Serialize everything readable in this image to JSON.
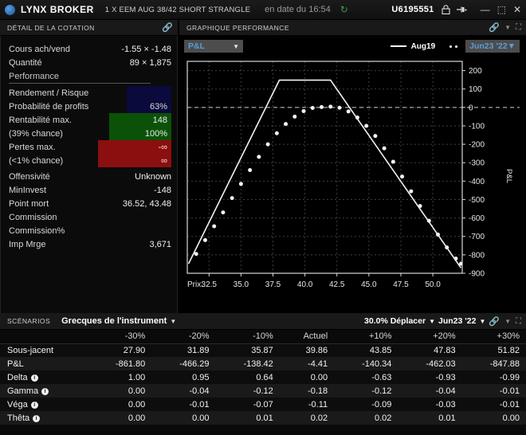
{
  "titlebar": {
    "brand": "LYNX BROKER",
    "description": "1 X EEM AUG 38/42 SHORT STRANGLE",
    "date_label": "en date du 16:54",
    "account": "U6195551",
    "refresh_icon": "refresh-icon",
    "lock_icon": "lock-icon",
    "pin_icon": "pin-icon",
    "minimize": "—",
    "maximize": "⬚",
    "close": "✕"
  },
  "quote_panel": {
    "header": "DÉTAIL DE LA COTATION",
    "rows": [
      {
        "label": "Cours ach/vend",
        "value": "-1.55 × -1.48"
      },
      {
        "label": "Quantité",
        "value": "89 × 1,875"
      }
    ],
    "section_label": "Performance",
    "perf": [
      {
        "label": "Rendement / Risque",
        "value": "",
        "style": "navy"
      },
      {
        "label": "Probabilité de profits",
        "value": "63%",
        "style": "navy"
      },
      {
        "label": "Rentabilité max.",
        "value": "148",
        "style": "green"
      },
      {
        "label": "(39% chance)",
        "value": "100%",
        "style": "green"
      },
      {
        "label": "Pertes max.",
        "value": "-∞",
        "style": "red"
      },
      {
        "label": "(<1% chance)",
        "value": "∞",
        "style": "red"
      }
    ],
    "tail": [
      {
        "label": "Offensivité",
        "value": "Unknown"
      },
      {
        "label": "MinInvest",
        "value": "-148"
      },
      {
        "label": "Point mort",
        "value": "36.52, 43.48"
      },
      {
        "label": "Commission",
        "value": ""
      },
      {
        "label": "Commission%",
        "value": ""
      },
      {
        "label": "Imp Mrge",
        "value": "3,671"
      }
    ]
  },
  "chart_panel": {
    "header": "GRAPHIQUE PERFORMANCE",
    "metric_dropdown": "P&L",
    "legend_solid": "Aug19",
    "legend_dotted": "Jun23 '22"
  },
  "chart_data": {
    "type": "line",
    "title": "GRAPHIQUE PERFORMANCE",
    "xlabel": "Prix:",
    "ylabel": "P&L",
    "xlim": [
      30.8,
      52.3
    ],
    "ylim": [
      -900,
      250
    ],
    "xticks": [
      32.5,
      35.0,
      37.5,
      40.0,
      42.5,
      45.0,
      47.5,
      50.0
    ],
    "yticks": [
      200,
      100,
      0,
      -100,
      -200,
      -300,
      -400,
      -500,
      -600,
      -700,
      -800,
      -900
    ],
    "grid": true,
    "legend_position": "top-right",
    "zero_line": 0,
    "series": [
      {
        "name": "Aug19",
        "style": "solid",
        "x": [
          30.9,
          38.0,
          42.0,
          52.2
        ],
        "values": [
          -848,
          148,
          148,
          -871
        ]
      },
      {
        "name": "Jun23 '22",
        "style": "dotted",
        "x": [
          31.5,
          32.2,
          32.9,
          33.6,
          34.3,
          35.0,
          35.7,
          36.4,
          37.1,
          37.8,
          38.5,
          39.2,
          39.9,
          40.6,
          41.3,
          42.0,
          42.7,
          43.4,
          44.1,
          44.8,
          45.5,
          46.2,
          46.9,
          47.6,
          48.3,
          49.0,
          49.7,
          50.4,
          51.1,
          51.8,
          52.2
        ],
        "values": [
          -795,
          -720,
          -645,
          -570,
          -492,
          -415,
          -340,
          -268,
          -200,
          -140,
          -90,
          -50,
          -20,
          -3,
          2,
          4,
          -2,
          -22,
          -55,
          -100,
          -155,
          -222,
          -295,
          -375,
          -455,
          -535,
          -615,
          -690,
          -760,
          -820,
          -848
        ]
      }
    ]
  },
  "scenarios": {
    "tab": "SCÉNARIOS",
    "title": "Grecques de l'instrument",
    "move_option": "30.0% Déplacer",
    "date_option": "Jun23 '22",
    "columns": [
      "",
      "-30%",
      "-20%",
      "-10%",
      "Actuel",
      "+10%",
      "+20%",
      "+30%"
    ],
    "rows": [
      {
        "label": "Sous-jacent",
        "info": false,
        "values": [
          "27.90",
          "31.89",
          "35.87",
          "39.86",
          "43.85",
          "47.83",
          "51.82"
        ]
      },
      {
        "label": "P&L",
        "info": false,
        "values": [
          "-861.80",
          "-466.29",
          "-138.42",
          "-4.41",
          "-140.34",
          "-462.03",
          "-847.88"
        ]
      },
      {
        "label": "Delta",
        "info": true,
        "values": [
          "1.00",
          "0.95",
          "0.64",
          "0.00",
          "-0.63",
          "-0.93",
          "-0.99"
        ]
      },
      {
        "label": "Gamma",
        "info": true,
        "values": [
          "0.00",
          "-0.04",
          "-0.12",
          "-0.18",
          "-0.12",
          "-0.04",
          "-0.01"
        ]
      },
      {
        "label": "Véga",
        "info": true,
        "values": [
          "0.00",
          "-0.01",
          "-0.07",
          "-0.11",
          "-0.09",
          "-0.03",
          "-0.01"
        ]
      },
      {
        "label": "Thêta",
        "info": true,
        "values": [
          "0.00",
          "0.00",
          "0.01",
          "0.02",
          "0.02",
          "0.01",
          "0.00"
        ]
      }
    ]
  },
  "colors": {
    "accent_green": "#49b356",
    "accent_blue": "#5b9bd5",
    "profit_bg": "#0b5208",
    "loss_bg": "#8b0f0f",
    "navy_bg": "#0a0a3c"
  }
}
